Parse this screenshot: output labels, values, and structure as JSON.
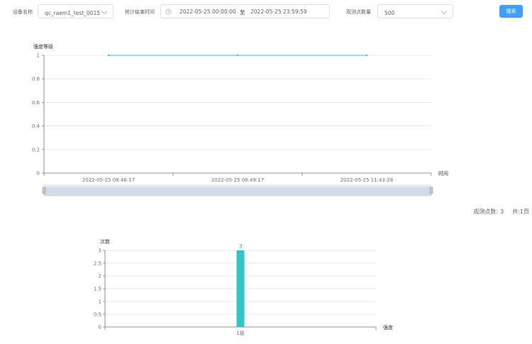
{
  "filters": {
    "device_label": "设备名称",
    "device_value": "qc_raem1_test_0015",
    "time_label": "统计结束时间",
    "time_start": "2022-05-25 00:00:00",
    "time_sep": "至",
    "time_end": "2022-05-25 23:59:59",
    "points_label": "观测点数量",
    "points_value": "500",
    "search_label": "搜索"
  },
  "summary": {
    "points_label": "观测点数:",
    "points_value": "3",
    "pages_label": "共:1页"
  },
  "colors": {
    "accent": "#409eff",
    "series": "#2ec7c9"
  },
  "chart_data": [
    {
      "type": "line",
      "ylabel": "强度等级",
      "xlabel": "时间",
      "ylim": [
        0,
        1
      ],
      "yticks": [
        "0",
        "0.2",
        "0.4",
        "0.6",
        "0.8",
        "1"
      ],
      "x": [
        "2022-05-25 08:46:17",
        "2022-05-25 08:49:17",
        "2022-05-25 11:43:28"
      ],
      "values": [
        1,
        1,
        1
      ],
      "grid": true,
      "dataZoom": {
        "start": 0,
        "end": 100
      }
    },
    {
      "type": "bar",
      "ylabel": "次数",
      "xlabel": "强度",
      "ylim": [
        0,
        3
      ],
      "yticks": [
        "0",
        "0.5",
        "1",
        "1.5",
        "2",
        "2.5",
        "3"
      ],
      "categories": [
        "1级"
      ],
      "values": [
        3
      ],
      "data_labels": [
        "3"
      ],
      "grid": true
    }
  ]
}
